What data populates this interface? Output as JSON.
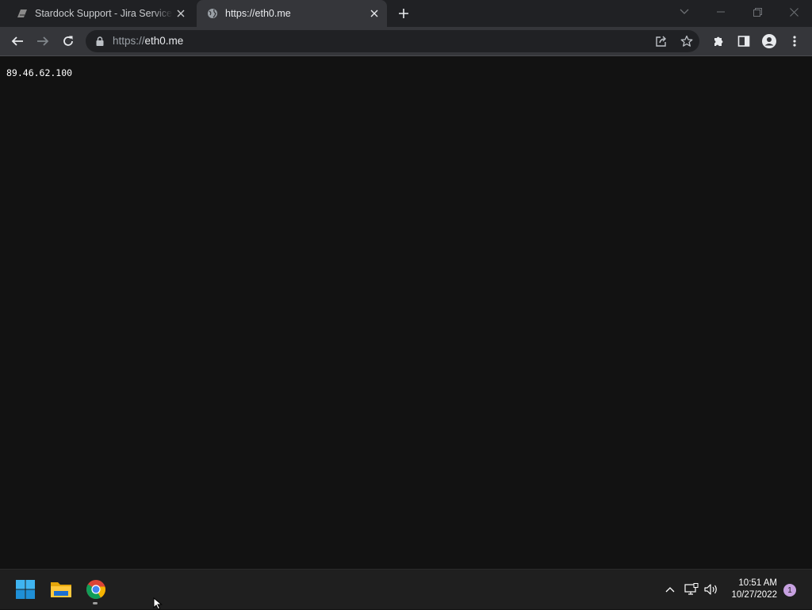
{
  "browser": {
    "tabs": [
      {
        "title": "Stardock Support - Jira Service Management",
        "icon": "stardock-favicon-icon",
        "active": false
      },
      {
        "title": "https://eth0.me",
        "icon": "globe-icon",
        "active": true
      }
    ],
    "address_bar": {
      "scheme": "https://",
      "host": "eth0.me"
    },
    "toolbar_icons": [
      "back-icon",
      "forward-icon",
      "reload-icon",
      "lock-icon",
      "share-icon",
      "bookmark-star-icon",
      "extensions-icon",
      "side-panel-icon",
      "profile-icon",
      "menu-icon"
    ]
  },
  "page": {
    "ip_address": "89.46.62.100"
  },
  "taskbar": {
    "apps": [
      "windows-start-icon",
      "file-explorer-icon",
      "chrome-icon"
    ],
    "tray_icons": [
      "chevron-up-icon",
      "network-icon",
      "volume-icon"
    ],
    "clock": {
      "time": "10:51 AM",
      "date": "10/27/2022"
    },
    "notification_count": "1"
  },
  "colors": {
    "tabstrip_bg": "#202124",
    "toolbar_bg": "#35363a",
    "page_bg": "#121212",
    "taskbar_bg": "#1f1f1f",
    "notification_badge": "#c7a1e0"
  }
}
